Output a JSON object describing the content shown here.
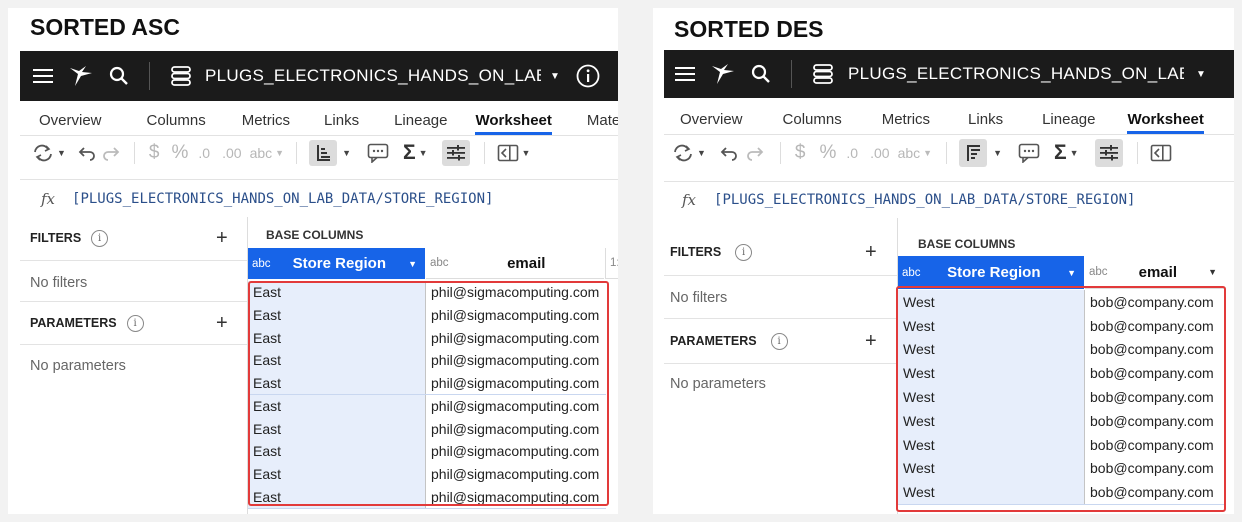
{
  "left": {
    "caption": "SORTED ASC",
    "dataset_name": "PLUGS_ELECTRONICS_HANDS_ON_LAB_...",
    "tabs": [
      "Overview",
      "Columns",
      "Metrics",
      "Links",
      "Lineage",
      "Worksheet",
      "Mate"
    ],
    "active_tab": "Worksheet",
    "formula": "[PLUGS_ELECTRONICS_HANDS_ON_LAB_DATA/STORE_REGION]",
    "filters_title": "FILTERS",
    "filters_empty": "No filters",
    "parameters_title": "PARAMETERS",
    "parameters_empty": "No parameters",
    "base_columns": "BASE COLUMNS",
    "col1": {
      "type": "abc",
      "name": "Store Region"
    },
    "col2": {
      "type": "abc",
      "name": "email"
    },
    "col3_type": "1:",
    "rows": [
      [
        "East",
        "phil@sigmacomputing.com"
      ],
      [
        "East",
        "phil@sigmacomputing.com"
      ],
      [
        "East",
        "phil@sigmacomputing.com"
      ],
      [
        "East",
        "phil@sigmacomputing.com"
      ],
      [
        "East",
        "phil@sigmacomputing.com"
      ],
      [
        "East",
        "phil@sigmacomputing.com"
      ],
      [
        "East",
        "phil@sigmacomputing.com"
      ],
      [
        "East",
        "phil@sigmacomputing.com"
      ],
      [
        "East",
        "phil@sigmacomputing.com"
      ],
      [
        "East",
        "phil@sigmacomputing.com"
      ]
    ],
    "sort_icon": "sort-ascending-icon"
  },
  "right": {
    "caption": "SORTED DES",
    "dataset_name": "PLUGS_ELECTRONICS_HANDS_ON_LAB_...",
    "tabs": [
      "Overview",
      "Columns",
      "Metrics",
      "Links",
      "Lineage",
      "Worksheet"
    ],
    "active_tab": "Worksheet",
    "formula": "[PLUGS_ELECTRONICS_HANDS_ON_LAB_DATA/STORE_REGION]",
    "filters_title": "FILTERS",
    "filters_empty": "No filters",
    "parameters_title": "PARAMETERS",
    "parameters_empty": "No parameters",
    "base_columns": "BASE COLUMNS",
    "col1": {
      "type": "abc",
      "name": "Store Region"
    },
    "col2": {
      "type": "abc",
      "name": "email"
    },
    "rows": [
      [
        "West",
        "bob@company.com"
      ],
      [
        "West",
        "bob@company.com"
      ],
      [
        "West",
        "bob@company.com"
      ],
      [
        "West",
        "bob@company.com"
      ],
      [
        "West",
        "bob@company.com"
      ],
      [
        "West",
        "bob@company.com"
      ],
      [
        "West",
        "bob@company.com"
      ],
      [
        "West",
        "bob@company.com"
      ],
      [
        "West",
        "bob@company.com"
      ]
    ],
    "sort_icon": "sort-descending-icon"
  },
  "toolbar": {
    "currency": "$",
    "percent": "%",
    "dec_minus": ".0",
    "dec_plus": ".00",
    "type_abc": "abc",
    "sigma": "Σ"
  },
  "colors": {
    "topbar": "#1b1b1b",
    "accent": "#1764e8",
    "selected_cell": "#e7eefb",
    "highlight": "#e23a3a"
  }
}
